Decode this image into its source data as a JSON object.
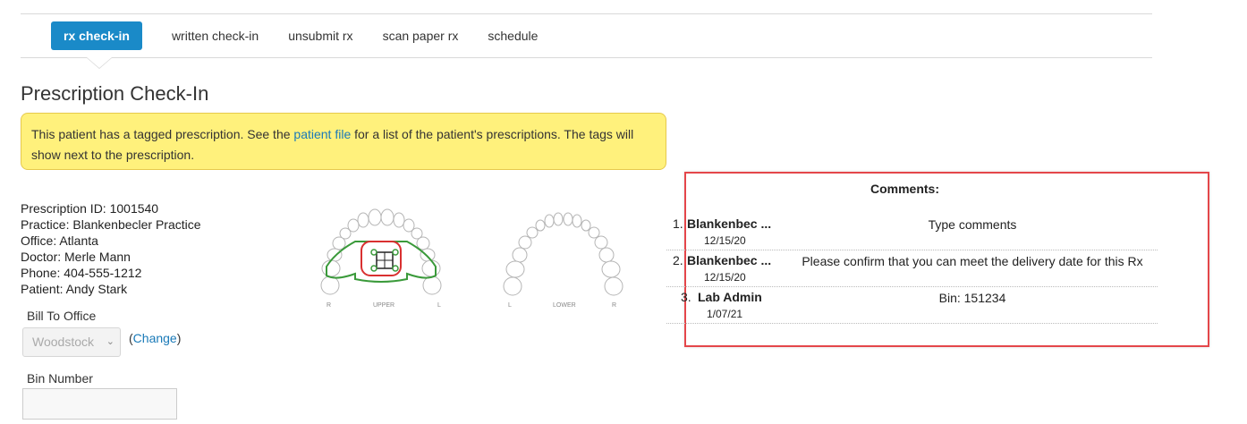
{
  "nav": {
    "tabs": [
      {
        "label": "rx check-in",
        "active": true
      },
      {
        "label": "written check-in",
        "active": false
      },
      {
        "label": "unsubmit rx",
        "active": false
      },
      {
        "label": "scan paper rx",
        "active": false
      },
      {
        "label": "schedule",
        "active": false
      }
    ]
  },
  "page": {
    "title": "Prescription Check-In"
  },
  "alert": {
    "text_before": "This patient has a tagged prescription. See the ",
    "link": "patient file",
    "text_after": " for a list of the patient's prescriptions. The tags will show next to the prescription."
  },
  "info": {
    "prescription_id": "Prescription ID: 1001540",
    "practice": "Practice: Blankenbecler Practice",
    "office": "Office: Atlanta",
    "doctor": "Doctor: Merle Mann",
    "phone": "Phone: 404-555-1212",
    "patient": "Patient: Andy Stark"
  },
  "bill_to": {
    "label": "Bill To Office",
    "selected": "Woodstock",
    "change_open": "(",
    "change_link": "Change",
    "change_close": ")"
  },
  "bin": {
    "label": "Bin Number",
    "value": ""
  },
  "arches": {
    "upper": {
      "label": "UPPER",
      "left": "R",
      "right": "L"
    },
    "lower": {
      "label": "LOWER",
      "left": "L",
      "right": "R"
    },
    "colors": {
      "tooth": "#b5b5b5",
      "green": "#3a9a3a",
      "red": "#d93030"
    }
  },
  "comments": {
    "title": "Comments:",
    "items": [
      {
        "num": "1.",
        "author": "Blankenbec ...",
        "date": "12/15/20",
        "text": "Type comments"
      },
      {
        "num": "2.",
        "author": "Blankenbec ...",
        "date": "12/15/20",
        "text": "Please confirm that you can meet the delivery date for this Rx"
      },
      {
        "num": "3.",
        "author": "Lab Admin",
        "date": "1/07/21",
        "text": "Bin: 151234"
      }
    ],
    "highlight_color": "#e4464a"
  },
  "colors": {
    "accent": "#1a8ac8",
    "link": "#1a7ab8",
    "alert_bg": "#fff17c"
  }
}
